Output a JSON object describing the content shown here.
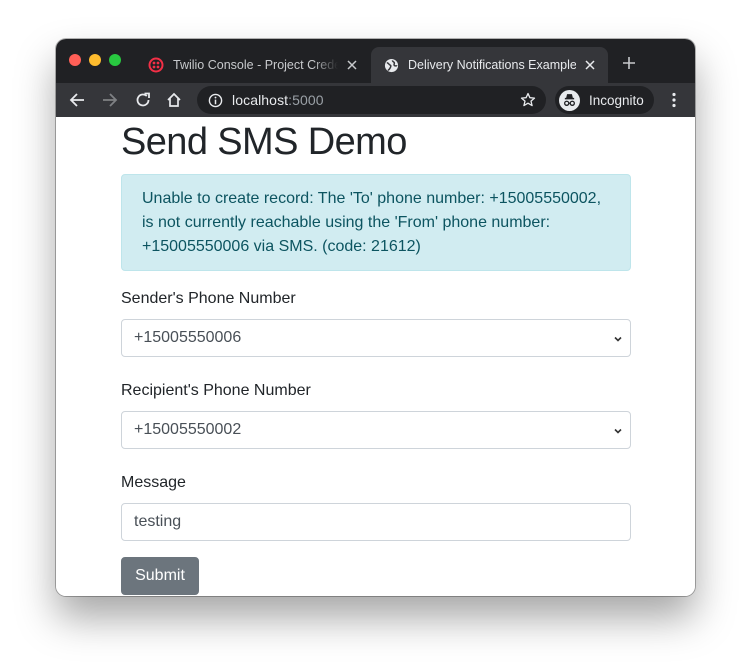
{
  "browser": {
    "tabs": [
      {
        "title": "Twilio Console - Project Credentials",
        "favicon": "twilio-icon",
        "active": false
      },
      {
        "title": "Delivery Notifications Example",
        "favicon": "globe-icon",
        "active": true
      }
    ],
    "new_tab_icon": "plus-icon",
    "nav": {
      "back": "arrow-left-icon",
      "forward": "arrow-right-icon",
      "reload": "reload-icon",
      "home": "home-icon"
    },
    "address": {
      "host": "localhost",
      "port": ":5000"
    },
    "bookmark_icon": "star-icon",
    "incognito_label": "Incognito",
    "menu_icon": "kebab-menu-icon",
    "colors": {
      "tabstrip": "#202124",
      "toolbar": "#35363a",
      "twilio_red": "#f22f46"
    }
  },
  "page": {
    "title": "Send SMS Demo",
    "alert": {
      "type": "info",
      "text": "Unable to create record: The 'To' phone number: +15005550002, is not currently reachable using the 'From' phone number: +15005550006 via SMS. (code: 21612)",
      "colors": {
        "background": "#d1ecf1",
        "border": "#bee5eb",
        "text": "#0c5460"
      }
    },
    "form": {
      "sender": {
        "label": "Sender's Phone Number",
        "selected": "+15005550006"
      },
      "recipient": {
        "label": "Recipient's Phone Number",
        "selected": "+15005550002"
      },
      "message": {
        "label": "Message",
        "value": "testing"
      },
      "submit_label": "Submit",
      "submit_color": "#6c757d"
    }
  }
}
